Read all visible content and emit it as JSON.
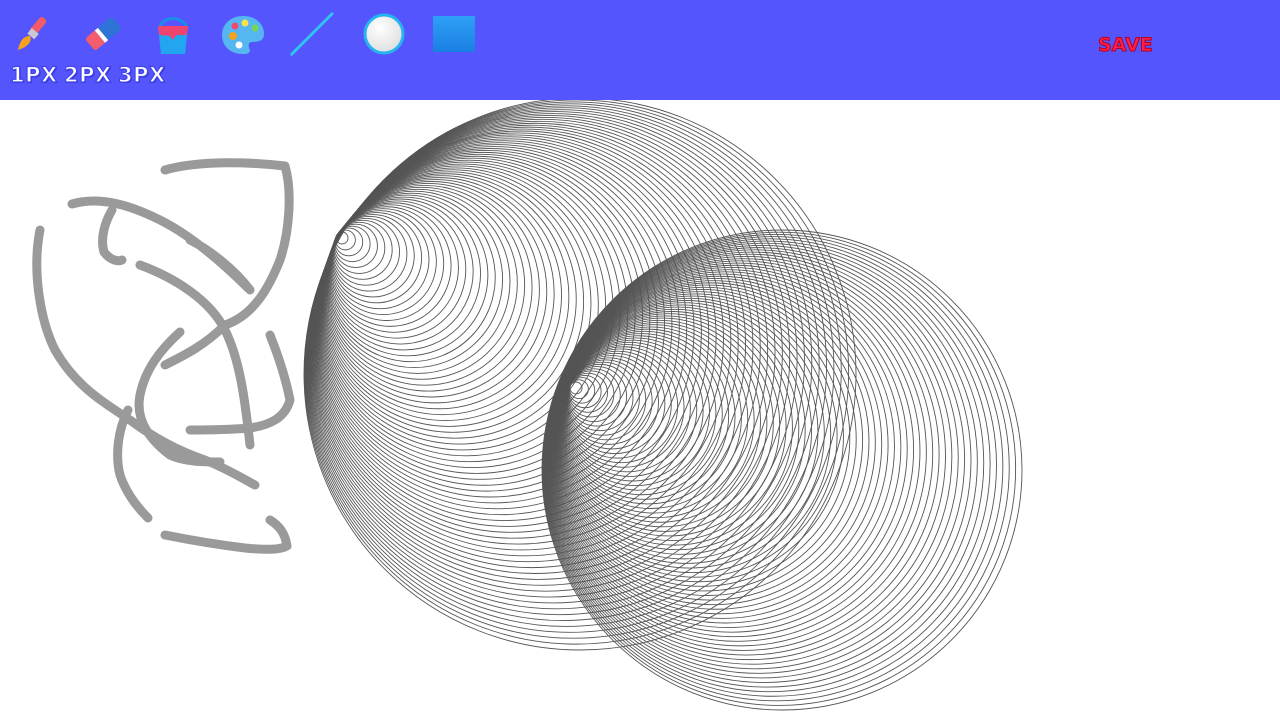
{
  "toolbar": {
    "tools": [
      {
        "name": "brush-icon",
        "label": "Brush"
      },
      {
        "name": "eraser-icon",
        "label": "Eraser"
      },
      {
        "name": "paint-bucket-icon",
        "label": "Fill"
      },
      {
        "name": "palette-icon",
        "label": "Color palette"
      },
      {
        "name": "line-tool-icon",
        "label": "Line"
      },
      {
        "name": "circle-tool-icon",
        "label": "Circle"
      },
      {
        "name": "rectangle-tool-icon",
        "label": "Rectangle"
      }
    ],
    "sizes": [
      "1PX",
      "2PX",
      "3PX"
    ],
    "save_label": "SAVE"
  },
  "colors": {
    "toolbar_bg": "#5555fe",
    "canvas_bg": "#ffffff",
    "stroke_gray": "#9a9a9a",
    "circle_stroke": "#555555",
    "save_text": "#ff1e4d"
  }
}
